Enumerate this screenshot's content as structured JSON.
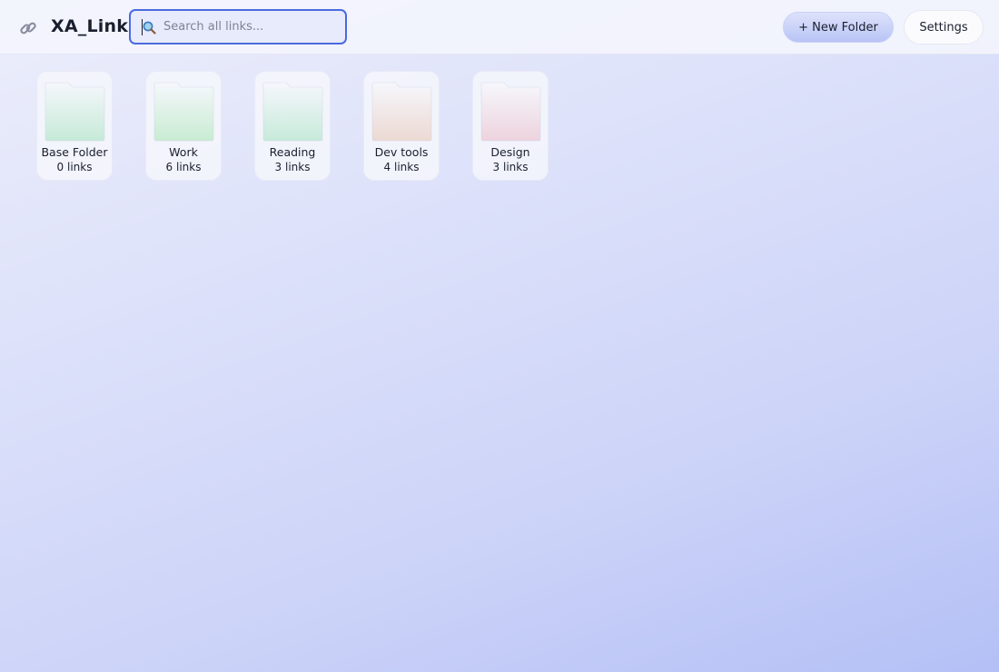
{
  "app": {
    "title": "XA_Link",
    "icon": "link-icon"
  },
  "search": {
    "placeholder": "Search all links...",
    "value": "",
    "icon": "magnifier-icon"
  },
  "toolbar": {
    "new_folder_label": "+ New Folder",
    "settings_label": "Settings"
  },
  "folders": [
    {
      "name": "Base Folder",
      "count": "0 links",
      "color": "#c6ead8"
    },
    {
      "name": "Work",
      "count": "6 links",
      "color": "#c8ecd2"
    },
    {
      "name": "Reading",
      "count": "3 links",
      "color": "#c7eada"
    },
    {
      "name": "Dev tools",
      "count": "4 links",
      "color": "#ecd9d3"
    },
    {
      "name": "Design",
      "count": "3 links",
      "color": "#edd3de"
    }
  ],
  "colors": {
    "accent": "#4a6ae0",
    "new_folder_button": "#b9c4f5"
  }
}
